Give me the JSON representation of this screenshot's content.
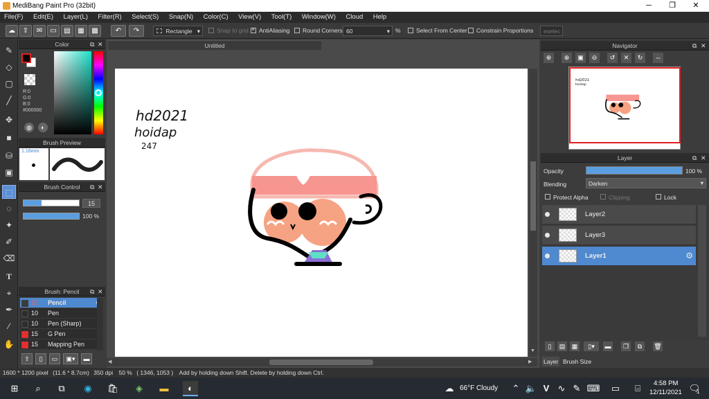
{
  "window": {
    "title": "MediBang Paint Pro (32bit)",
    "min": "─",
    "restore": "❐",
    "close": "✕"
  },
  "menu": [
    "File(F)",
    "Edit(E)",
    "Layer(L)",
    "Filter(R)",
    "Select(S)",
    "Snap(N)",
    "Color(C)",
    "View(V)",
    "Tool(T)",
    "Window(W)",
    "Cloud",
    "Help"
  ],
  "toolbar": {
    "shape": "Rectangle",
    "snap_to_grid": "Snap to grid",
    "antialiasing": "AntiAliasing",
    "round_corners": "Round Corners",
    "round_value": "60",
    "percent": "%",
    "select_from_center": "Select From Center",
    "constrain": "Constrain Proportions",
    "deselect": "eselec"
  },
  "color_panel": {
    "title": "Color",
    "r": "R:0",
    "g": "G:0",
    "b": "B:0",
    "hex": "#000000"
  },
  "brush_preview": {
    "title": "Brush Preview",
    "size": "1.16mm"
  },
  "brush_control": {
    "title": "Brush Control",
    "size_value": "15",
    "opacity_value": "100 %",
    "size_fraction": 0.33,
    "opacity_fraction": 1.0
  },
  "brush_panel": {
    "title": "Brush: Pencil",
    "items": [
      {
        "size": "15",
        "name": "Pencil",
        "color": "#3c3c3c",
        "selected": true
      },
      {
        "size": "10",
        "name": "Pen",
        "color": "#2d2d2d"
      },
      {
        "size": "10",
        "name": "Pen (Sharp)",
        "color": "#2d2d2d"
      },
      {
        "size": "15",
        "name": "G Pen",
        "color": "#e03030"
      },
      {
        "size": "15",
        "name": "Mapping Pen",
        "color": "#e03030"
      }
    ]
  },
  "canvas": {
    "tab": "Untitled",
    "handwriting": [
      "hd2021",
      "hoidap",
      "247"
    ]
  },
  "navigator": {
    "title": "Navigator"
  },
  "layer_panel": {
    "title": "Layer",
    "opacity_label": "Opacity",
    "opacity_value": "100 %",
    "blending_label": "Blending",
    "blending_value": "Darken",
    "protect_alpha": "Protect Alpha",
    "clipping": "Clipping",
    "lock": "Lock",
    "layers": [
      "Layer2",
      "Layer3",
      "Layer1"
    ],
    "tabs": [
      "Layer",
      "Brush Size"
    ]
  },
  "status": {
    "dims": "1600 * 1200 pixel",
    "phys": "(11.6 * 8.7cm)",
    "dpi": "350 dpi",
    "zoom": "50 %",
    "coords": "( 1346, 1053 )",
    "hint": "Add by holding down Shift. Delete by holding down Ctrl."
  },
  "taskbar": {
    "weather": "66°F  Cloudy",
    "time": "4:58 PM",
    "date": "12/11/2021",
    "notifications": "1"
  },
  "colors": {
    "accent": "#4f89cf",
    "panel": "#3c3c3c",
    "dark": "#2b2b2b"
  }
}
